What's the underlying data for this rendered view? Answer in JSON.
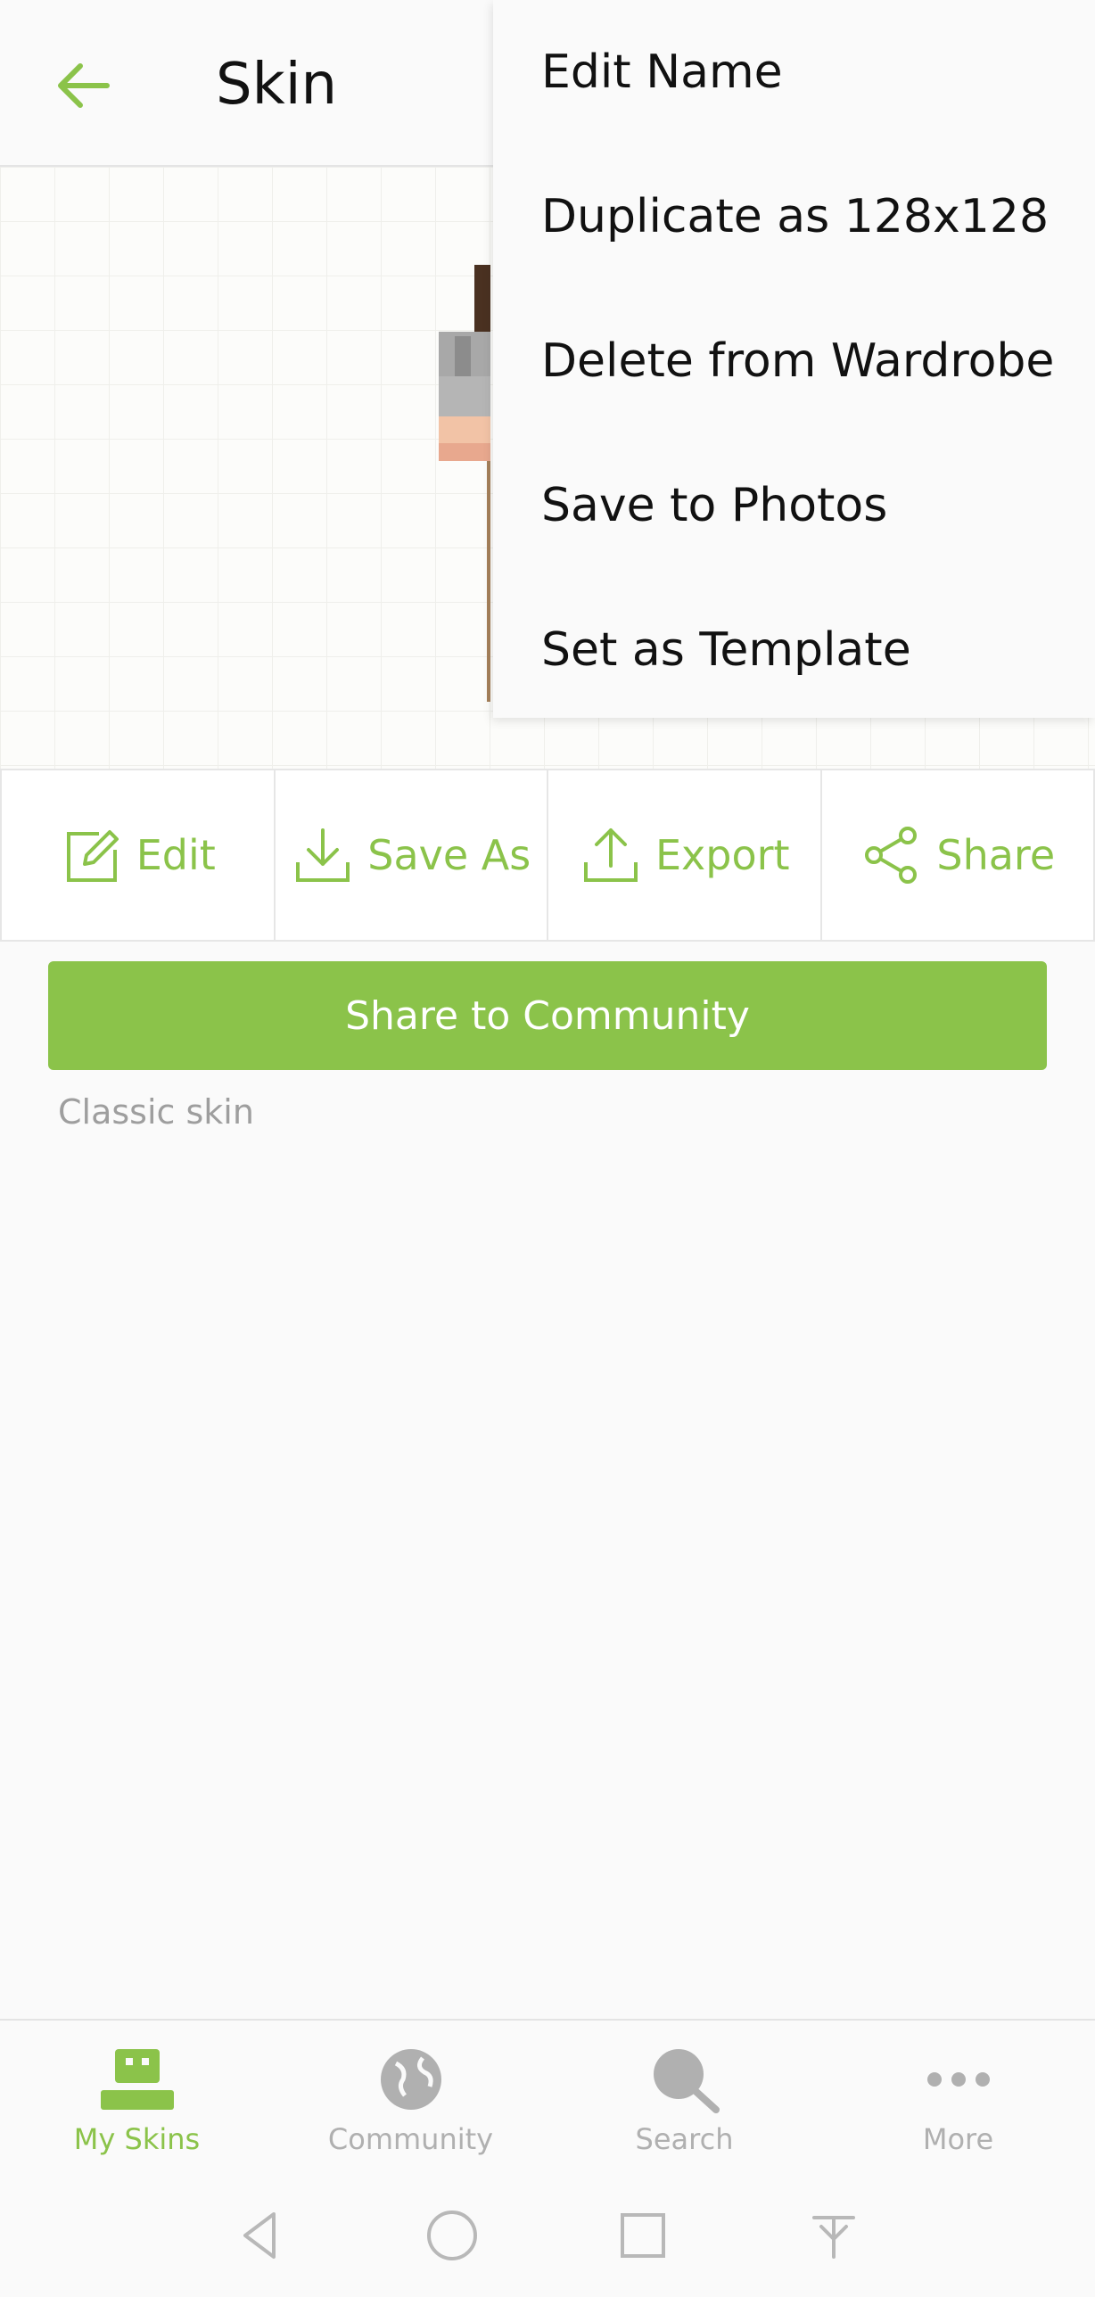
{
  "header": {
    "title": "Skin"
  },
  "menu": {
    "items": [
      "Edit Name",
      "Duplicate as 128x128",
      "Delete from Wardrobe",
      "Save to Photos",
      "Set as Template"
    ]
  },
  "actions": {
    "edit": "Edit",
    "save_as": "Save As",
    "export": "Export",
    "share": "Share"
  },
  "community_button": "Share to Community",
  "skin_type": "Classic skin",
  "bottom_nav": {
    "items": [
      {
        "label": "My Skins",
        "icon": "my-skins-icon",
        "active": true
      },
      {
        "label": "Community",
        "icon": "globe-icon",
        "active": false
      },
      {
        "label": "Search",
        "icon": "search-icon",
        "active": false
      },
      {
        "label": "More",
        "icon": "more-dots-icon",
        "active": false
      }
    ]
  },
  "colors": {
    "accent": "#8bc34a",
    "inactive": "#b0b0b0"
  }
}
